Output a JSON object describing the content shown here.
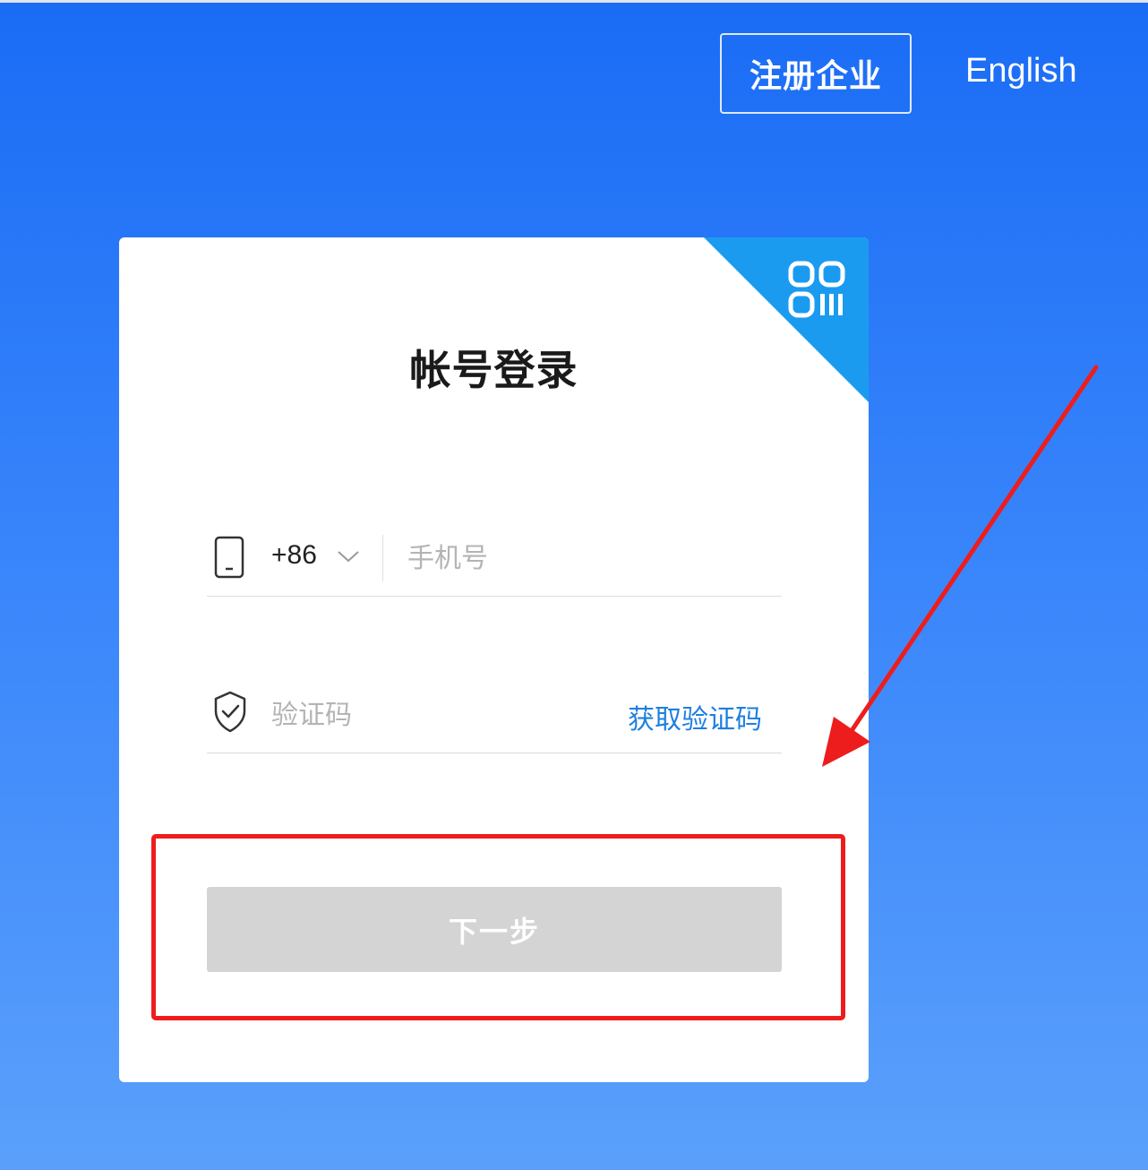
{
  "header": {
    "register_label": "注册企业",
    "language_label": "English"
  },
  "login_card": {
    "title": "帐号登录",
    "qr_icon": "qr-code-icon",
    "phone_field": {
      "icon": "phone-icon",
      "country_code": "+86",
      "placeholder": "手机号",
      "value": ""
    },
    "code_field": {
      "icon": "shield-check-icon",
      "placeholder": "验证码",
      "value": "",
      "get_code_label": "获取验证码"
    },
    "next_button_label": "下一步"
  },
  "annotation": {
    "highlight_color": "#ee1d1d"
  },
  "colors": {
    "background_top": "#1a6cf5",
    "background_bottom": "#5aa0fb",
    "accent": "#1b9bf0",
    "link": "#1d7fe0",
    "disabled_button": "#d4d4d5"
  }
}
